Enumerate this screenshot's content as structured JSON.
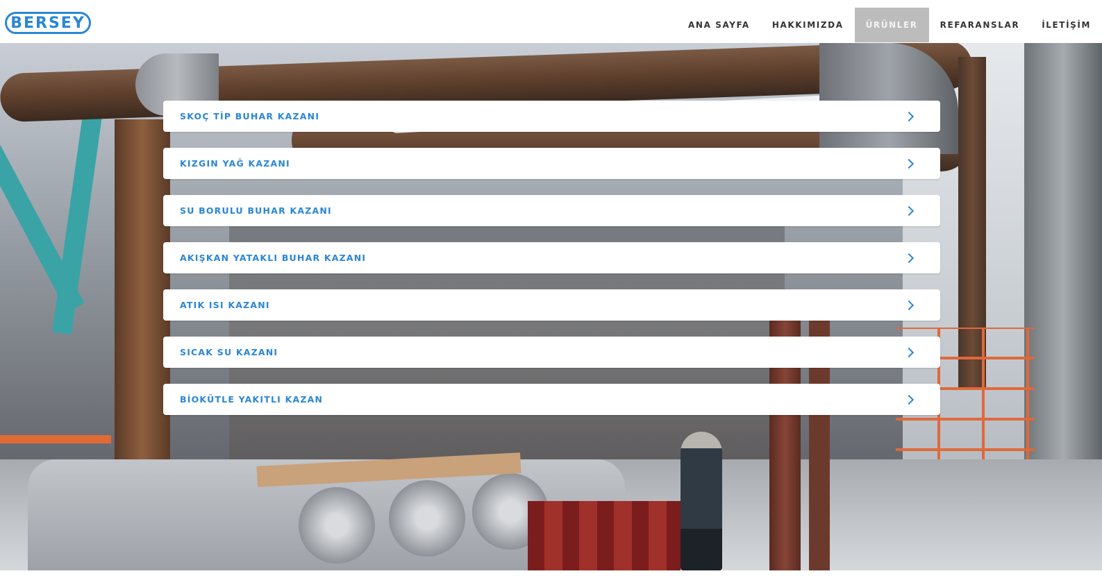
{
  "header": {
    "logo_text": "BERSEY",
    "nav": [
      {
        "label": "ANA SAYFA",
        "active": false
      },
      {
        "label": "HAKKIMIZDA",
        "active": false
      },
      {
        "label": "ÜRÜNLER",
        "active": true
      },
      {
        "label": "REFARANSLAR",
        "active": false
      },
      {
        "label": "İLETİŞİM",
        "active": false
      }
    ]
  },
  "products": [
    {
      "label": "SKOÇ TİP BUHAR KAZANI",
      "icon": "chevron-right-icon"
    },
    {
      "label": "KIZGIN YAĞ KAZANI",
      "icon": "chevron-right-icon"
    },
    {
      "label": "SU BORULU BUHAR KAZANI",
      "icon": "chevron-right-icon"
    },
    {
      "label": "AKIŞKAN YATAKLI BUHAR KAZANI",
      "icon": "chevron-right-icon"
    },
    {
      "label": "ATIK ISI KAZANI",
      "icon": "chevron-right-icon"
    },
    {
      "label": "SICAK SU KAZANI",
      "icon": "chevron-right-icon"
    },
    {
      "label": "BİOKÜTLE YAKITLI KAZAN",
      "icon": "chevron-right-icon"
    }
  ],
  "colors": {
    "brand": "#2a86d6",
    "nav_active_bg": "#bcbcbc",
    "nav_text": "#333333"
  }
}
